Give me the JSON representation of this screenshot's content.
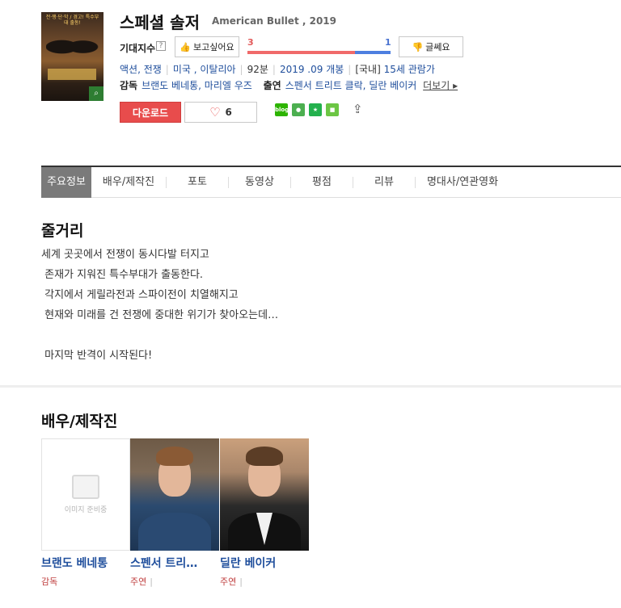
{
  "movie": {
    "title_ko": "스페셜 솔저",
    "title_en": "American Bullet , 2019",
    "poster": {
      "tagline": "전·쟁·단·막 / 경고! 특수부대 출동!",
      "zoom_icon": "magnifier-icon"
    }
  },
  "expectation": {
    "label": "기대지수",
    "help": "?",
    "want_label": "보고싶어요",
    "bad_label": "글쎄요",
    "want_count": "3",
    "bad_count": "1",
    "want_ratio": 0.75,
    "colors": {
      "want": "#f06a6a",
      "bad": "#4d7fe0"
    }
  },
  "meta": {
    "genre": "액션, 전쟁",
    "country": "미국 , 이탈리아",
    "runtime": "92분",
    "release": "2019 .09 개봉",
    "rating_prefix": "[국내]",
    "rating": "15세 관람가",
    "director_label": "감독",
    "directors": "브랜도 베네통, 마리엘 우즈",
    "cast_label": "출연",
    "cast": "스펜서 트리트 클락, 딜란 베이커",
    "more": "더보기 ▸"
  },
  "actions": {
    "download": "다운로드",
    "like_count": "6",
    "share_icons": [
      "blog",
      "talk",
      "star",
      "note"
    ],
    "share_out": "share-icon"
  },
  "tabs": [
    "주요정보",
    "배우/제작진",
    "포토",
    "동영상",
    "평점",
    "리뷰",
    "명대사/연관영화"
  ],
  "synopsis": {
    "title": "줄거리",
    "text": "세계 곳곳에서 전쟁이 동시다발 터지고\n 존재가 지워진 특수부대가 출동한다.\n 각지에서 게릴라전과 스파이전이 치열해지고\n 현재와 미래를 건 전쟁에 중대한 위기가 찾아오는데…\n\n 마지막 반격이 시작된다!"
  },
  "cast_section": {
    "title": "배우/제작진",
    "placeholder_text": "이미지 준비중",
    "people": [
      {
        "name": "브랜도 베네통",
        "role": "감독",
        "extra": ""
      },
      {
        "name": "스펜서 트리…",
        "role": "주연",
        "extra": "|"
      },
      {
        "name": "딜란 베이커",
        "role": "주연",
        "extra": "|"
      }
    ]
  }
}
